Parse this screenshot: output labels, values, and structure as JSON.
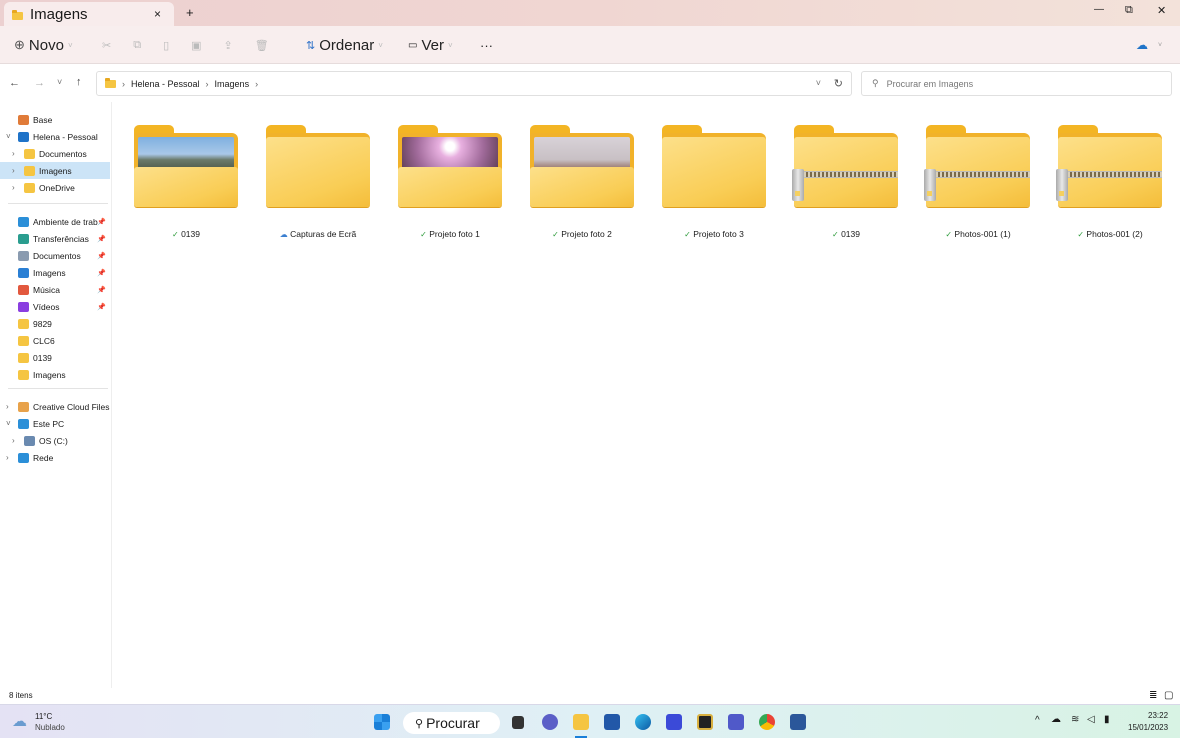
{
  "window": {
    "tab_title": "Imagens",
    "new_tab": "+",
    "close_tab": "×",
    "minimize": "—",
    "maximize": "⧉",
    "close": "✕"
  },
  "toolbar": {
    "new_label": "Novo",
    "sort_label": "Ordenar",
    "view_label": "Ver",
    "more": "···"
  },
  "address": {
    "breadcrumb": [
      "Helena - Pessoal",
      "Imagens"
    ],
    "search_placeholder": "Procurar em Imagens"
  },
  "sidebar": {
    "items": [
      {
        "label": "Base",
        "icon": "home-icon",
        "color": "#e07b39"
      },
      {
        "label": "Helena - Pessoal",
        "icon": "onedrive-icon",
        "color": "#1f73c8",
        "expanded": true
      },
      {
        "label": "Documentos",
        "icon": "folder-icon",
        "color": "#f5c542"
      },
      {
        "label": "Imagens",
        "icon": "folder-icon",
        "color": "#f5c542",
        "selected": true
      },
      {
        "label": "OneDrive",
        "icon": "folder-icon",
        "color": "#f5c542"
      },
      {
        "label": "Ambiente de trab",
        "icon": "desktop-icon",
        "color": "#2b8fd8",
        "pinned": true
      },
      {
        "label": "Transferências",
        "icon": "download-icon",
        "color": "#2a9d8f",
        "pinned": true
      },
      {
        "label": "Documentos",
        "icon": "documents-icon",
        "color": "#8a9bb0",
        "pinned": true
      },
      {
        "label": "Imagens",
        "icon": "pictures-icon",
        "color": "#2a7fd4",
        "pinned": true
      },
      {
        "label": "Música",
        "icon": "music-icon",
        "color": "#e2583e",
        "pinned": true
      },
      {
        "label": "Vídeos",
        "icon": "videos-icon",
        "color": "#8a3ee0",
        "pinned": true
      },
      {
        "label": "9829",
        "icon": "folder-icon",
        "color": "#f5c542"
      },
      {
        "label": "CLC6",
        "icon": "folder-icon",
        "color": "#f5c542"
      },
      {
        "label": "0139",
        "icon": "folder-icon",
        "color": "#f5c542"
      },
      {
        "label": "Imagens",
        "icon": "folder-icon",
        "color": "#f5c542"
      },
      {
        "label": "Creative Cloud Files",
        "icon": "creative-cloud-icon",
        "color": "#e8a24a"
      },
      {
        "label": "Este PC",
        "icon": "pc-icon",
        "color": "#2b8fd8",
        "expanded": true
      },
      {
        "label": "OS (C:)",
        "icon": "drive-icon",
        "color": "#6a8ab0"
      },
      {
        "label": "Rede",
        "icon": "network-icon",
        "color": "#2b8fd8"
      }
    ]
  },
  "files": [
    {
      "name": "0139",
      "type": "photo-folder",
      "status": "synced",
      "thumb": "linear-gradient(180deg,#7fb0e0 0%,#a9c8e8 45%,#6b7a6a 60%,#3f4a3a 100%)"
    },
    {
      "name": "Capturas de Ecrã",
      "type": "folder",
      "status": "cloud"
    },
    {
      "name": "Projeto foto 1",
      "type": "photo-folder",
      "status": "synced",
      "thumb": "radial-gradient(circle at 50% 25%,#fff 0 8%,#e8b0e0 20%,#a06a9a 60%,#5a3a50 100%)"
    },
    {
      "name": "Projeto foto 2",
      "type": "photo-folder",
      "status": "synced",
      "thumb": "linear-gradient(180deg,#d8d2d8 0%,#c8c0c4 60%,#8a6050 90%)"
    },
    {
      "name": "Projeto foto 3",
      "type": "folder",
      "status": "synced"
    },
    {
      "name": "0139",
      "type": "zip",
      "status": "synced"
    },
    {
      "name": "Photos-001 (1)",
      "type": "zip",
      "status": "synced"
    },
    {
      "name": "Photos-001 (2)",
      "type": "zip",
      "status": "synced"
    }
  ],
  "status": {
    "count": "8 itens"
  },
  "taskbar": {
    "temp": "11°C",
    "weather": "Nublado",
    "search": "Procurar",
    "time": "23:22",
    "date": "15/01/2023"
  }
}
